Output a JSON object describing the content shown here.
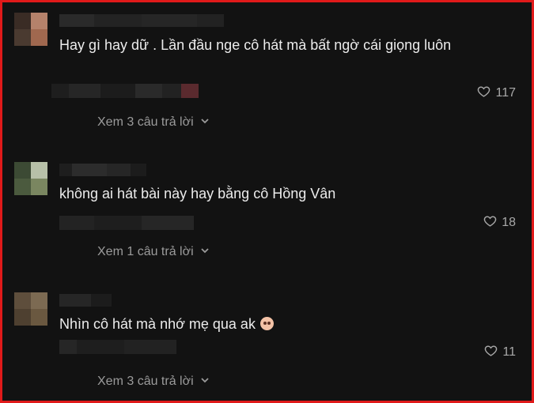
{
  "comments": [
    {
      "text": "Hay gì hay dữ . Lần đầu nge cô hát mà bất ngờ cái giọng luôn",
      "likes": "117",
      "replies_label": "Xem 3 câu trả lời"
    },
    {
      "text": "không ai hát bài này hay bằng cô Hồng Vân",
      "likes": "18",
      "replies_label": "Xem 1 câu trả lời"
    },
    {
      "text": "Nhìn cô hát mà nhớ mẹ qua ak",
      "likes": "11",
      "replies_label": "Xem 3 câu trả lời",
      "emoji": "anguished-face"
    }
  ],
  "icons": {
    "like": "heart-outline-icon",
    "expand": "chevron-down-icon"
  },
  "colors": {
    "background": "#121212",
    "frame_border": "#e01a1a",
    "text": "#ececec",
    "muted": "#9b9b9b"
  }
}
